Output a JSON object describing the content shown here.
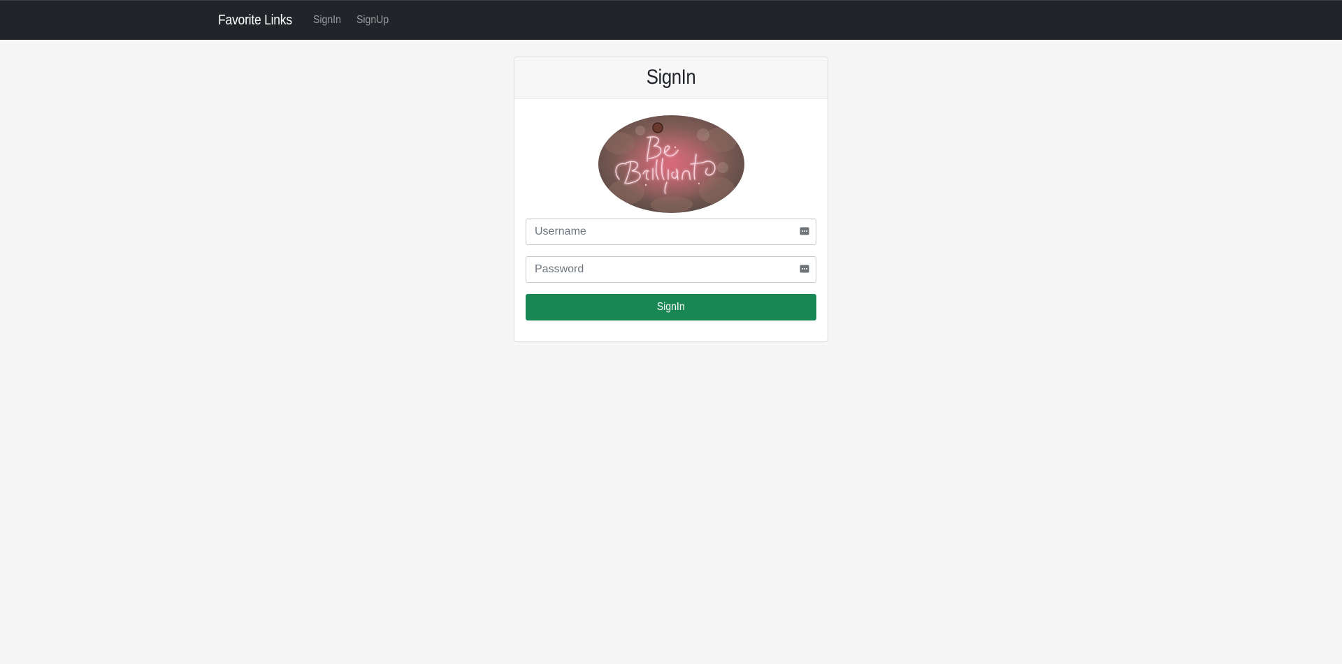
{
  "navbar": {
    "brand": "Favorite Links",
    "links": [
      {
        "label": "SignIn"
      },
      {
        "label": "SignUp"
      }
    ]
  },
  "signin_card": {
    "title": "SignIn",
    "logo": {
      "lettering": "Be Brilliant",
      "icon": "neon-sign-image"
    },
    "username": {
      "placeholder": "Username",
      "value": "",
      "icon": "password-manager-key-icon"
    },
    "password": {
      "placeholder": "Password",
      "value": "",
      "icon": "password-manager-key-icon"
    },
    "submit_label": "SignIn"
  },
  "colors": {
    "navbar_bg": "#212529",
    "page_bg": "#f5f5f5",
    "button_bg": "#198754",
    "neon_pink": "#ff4d7a"
  }
}
